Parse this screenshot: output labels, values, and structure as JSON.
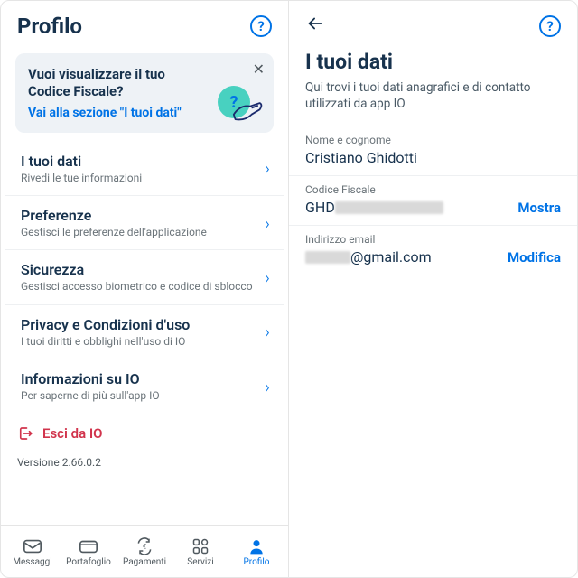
{
  "left": {
    "title": "Profilo",
    "banner": {
      "text": "Vuoi visualizzare il tuo Codice Fiscale?",
      "link": "Vai alla sezione \"I tuoi dati\""
    },
    "items": [
      {
        "title": "I tuoi dati",
        "sub": "Rivedi le tue informazioni"
      },
      {
        "title": "Preferenze",
        "sub": "Gestisci le preferenze dell'applicazione"
      },
      {
        "title": "Sicurezza",
        "sub": "Gestisci accesso biometrico e codice di sblocco"
      },
      {
        "title": "Privacy e Condizioni d'uso",
        "sub": "I tuoi diritti e obblighi nell'uso di IO"
      },
      {
        "title": "Informazioni su IO",
        "sub": "Per saperne di più sull'app IO"
      }
    ],
    "logout": "Esci da IO",
    "version": "Versione 2.66.0.2",
    "tabs": {
      "messages": "Messaggi",
      "wallet": "Portafoglio",
      "payments": "Pagamenti",
      "services": "Servizi",
      "profile": "Profilo"
    }
  },
  "right": {
    "title": "I tuoi dati",
    "desc": "Qui trovi i tuoi dati anagrafici e di contatto utilizzati da app IO",
    "fields": {
      "name": {
        "label": "Nome e cognome",
        "value": "Cristiano Ghidotti"
      },
      "cf": {
        "label": "Codice Fiscale",
        "prefix": "GHD",
        "action": "Mostra"
      },
      "email": {
        "label": "Indirizzo email",
        "suffix": "@gmail.com",
        "action": "Modifica"
      }
    }
  }
}
